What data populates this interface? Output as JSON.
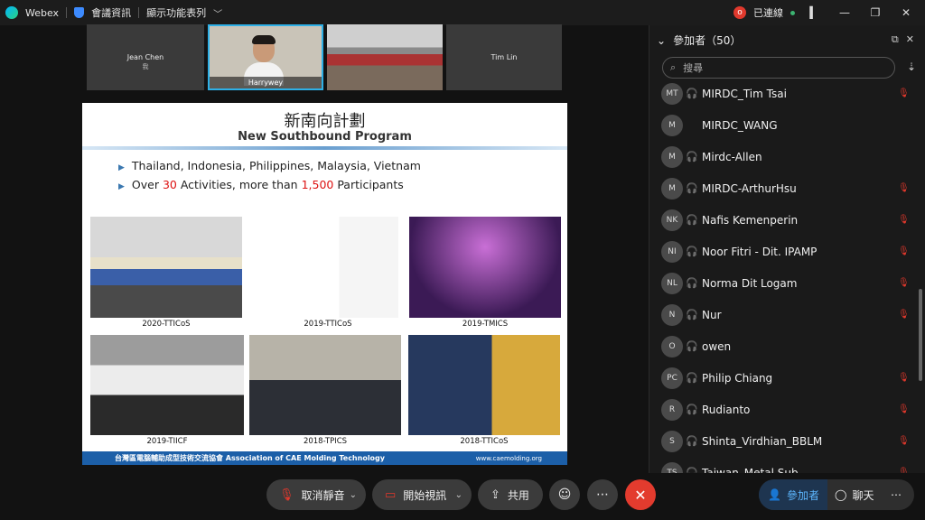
{
  "titlebar": {
    "app_name": "Webex",
    "meeting_info": "會議資訊",
    "layout_menu": "顯示功能表列",
    "rec_badge": "o",
    "connected": "已連線"
  },
  "video_strip": [
    {
      "name": "Jean Chen",
      "sub": "我"
    },
    {
      "name": "Harrywey"
    },
    {
      "name": ""
    },
    {
      "name": "Tim Lin"
    }
  ],
  "slide": {
    "title_zh": "新南向計劃",
    "title_en": "New Southbound Program",
    "bullet1": "Thailand, Indonesia, Philippines, Malaysia, Vietnam",
    "bullet2_a": "Over ",
    "bullet2_b": "30",
    "bullet2_c": " Activities, more than ",
    "bullet2_d": "1,500",
    "bullet2_e": " Participants",
    "photos": [
      {
        "caption": "2020-TTICoS"
      },
      {
        "caption": "2019-TTICoS"
      },
      {
        "caption": "2019-TMICS"
      },
      {
        "caption": "2019-TIICF"
      },
      {
        "caption": "2018-TPICS"
      },
      {
        "caption": "2018-TTICoS"
      }
    ],
    "footer_left": "台灣區電腦輔助成型技術交流協會 Association of CAE Molding Technology",
    "footer_right": "www.caemolding.org"
  },
  "participants": {
    "header": "參加者（50）",
    "search_placeholder": "搜尋",
    "list": [
      {
        "initials": "MT",
        "name": "MIRDC_Tim Tsai",
        "muted": true
      },
      {
        "initials": "M",
        "name": "MIRDC_WANG",
        "muted": false
      },
      {
        "initials": "M",
        "name": "Mirdc-Allen",
        "muted": false
      },
      {
        "initials": "M",
        "name": "MIRDC-ArthurHsu",
        "muted": true
      },
      {
        "initials": "NK",
        "name": "Nafis Kemenperin",
        "muted": true
      },
      {
        "initials": "NI",
        "name": "Noor Fitri - Dit. IPAMP",
        "muted": true
      },
      {
        "initials": "NL",
        "name": "Norma Dit Logam",
        "muted": true
      },
      {
        "initials": "N",
        "name": "Nur",
        "muted": true
      },
      {
        "initials": "O",
        "name": "owen",
        "muted": false
      },
      {
        "initials": "PC",
        "name": "Philip Chiang",
        "muted": true
      },
      {
        "initials": "R",
        "name": "Rudianto",
        "muted": true
      },
      {
        "initials": "S",
        "name": "Shinta_Virdhian_BBLM",
        "muted": true
      },
      {
        "initials": "TS",
        "name": "Taiwan_Metal Sub",
        "muted": true
      }
    ]
  },
  "toolbar": {
    "unmute": "取消靜音",
    "start_video": "開始視訊",
    "share": "共用",
    "participants": "參加者",
    "chat": "聊天"
  }
}
